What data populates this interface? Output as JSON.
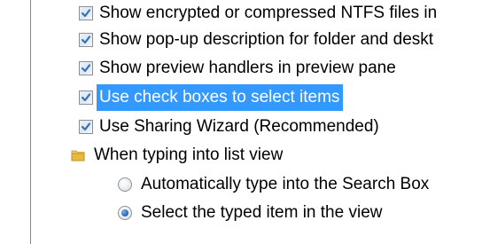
{
  "colors": {
    "selection_bg": "#3399ff",
    "selection_text": "#ffffff",
    "check_mark": "#3b6fb6",
    "radio_dot": "#2a6fc2",
    "folder": "#e8b93c",
    "border": "#828790"
  },
  "advanced_settings": {
    "checkbox_items": [
      {
        "label": "Show encrypted or compressed NTFS files in",
        "checked": true,
        "selected": false
      },
      {
        "label": "Show pop-up description for folder and deskt",
        "checked": true,
        "selected": false
      },
      {
        "label": "Show preview handlers in preview pane",
        "checked": true,
        "selected": false
      },
      {
        "label": "Use check boxes to select items",
        "checked": true,
        "selected": true
      },
      {
        "label": "Use Sharing Wizard (Recommended)",
        "checked": true,
        "selected": false
      }
    ],
    "group": {
      "label": "When typing into list view",
      "icon": "folder-icon",
      "options": [
        {
          "label": "Automatically type into the Search Box",
          "selected": false
        },
        {
          "label": "Select the typed item in the view",
          "selected": true
        }
      ]
    }
  }
}
